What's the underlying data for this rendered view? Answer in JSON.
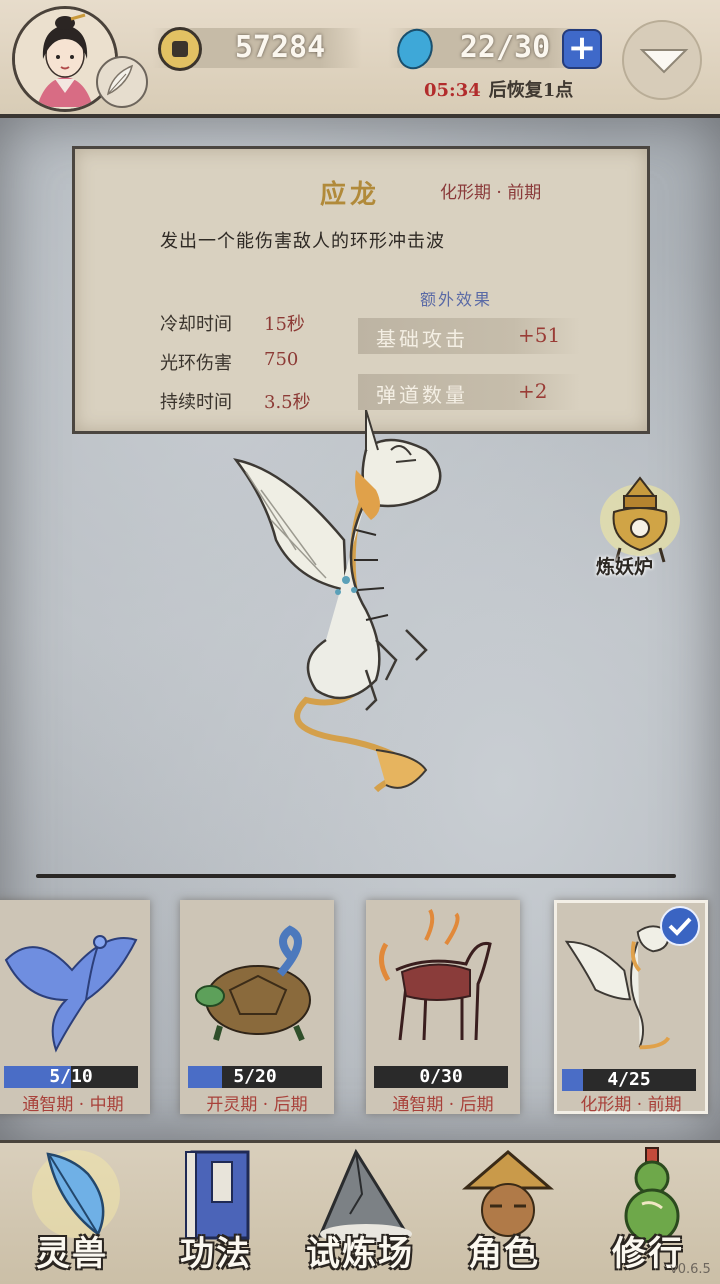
{
  "header": {
    "coins": "57284",
    "energy": "22/30",
    "recover_timer": "05:34",
    "recover_text": "后恢复1点"
  },
  "beast": {
    "name": "应龙",
    "stage": "化形期 · 前期",
    "description": "发出一个能伤害敌人的环形冲击波",
    "stats": [
      {
        "label": "冷却时间",
        "value": "15秒"
      },
      {
        "label": "光环伤害",
        "value": "750"
      },
      {
        "label": "持续时间",
        "value": "3.5秒"
      }
    ],
    "extra_title": "额外效果",
    "extras": [
      {
        "label": "基础攻击",
        "value": "+51"
      },
      {
        "label": "弹道数量",
        "value": "+2"
      }
    ]
  },
  "furnace": {
    "label": "炼妖炉"
  },
  "cards": [
    {
      "count": "5/10",
      "progress": 0.5,
      "stage": "通智期 · 中期",
      "selected": false
    },
    {
      "count": "5/20",
      "progress": 0.25,
      "stage": "开灵期 · 后期",
      "selected": false
    },
    {
      "count": "0/30",
      "progress": 0.0,
      "stage": "通智期 · 后期",
      "selected": false
    },
    {
      "count": "4/25",
      "progress": 0.16,
      "stage": "化形期 · 前期",
      "selected": true
    }
  ],
  "nav": [
    {
      "label": "灵兽",
      "icon": "feather-icon"
    },
    {
      "label": "功法",
      "icon": "book-icon"
    },
    {
      "label": "试炼场",
      "icon": "mountain-icon"
    },
    {
      "label": "角色",
      "icon": "character-icon"
    },
    {
      "label": "修行",
      "icon": "gourd-icon"
    }
  ],
  "version": "v0.6.5",
  "colors": {
    "accent_blue": "#3f69c9",
    "timer_red": "#b22c2c",
    "stage_red": "#a8413a",
    "name_gold": "#b18a3a"
  }
}
